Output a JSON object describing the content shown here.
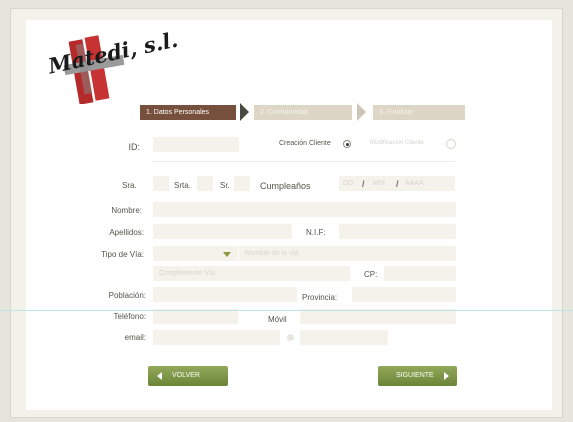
{
  "logo": {
    "text": "Matedi, s.l."
  },
  "steps": [
    {
      "label": "1. Datos Personales"
    },
    {
      "label": "2. Conformidad"
    },
    {
      "label": "3. Finalizar"
    }
  ],
  "form": {
    "id_label": "ID:",
    "creation_label": "Creación Cliente",
    "modify_label": "Modificacion Cliente",
    "sra_label": "Sra.",
    "srta_label": "Srta.",
    "sr_label": "Sr.",
    "birthday_label": "Cumpleaños",
    "dd_placeholder": "DD",
    "mm_placeholder": "MM",
    "yyyy_placeholder": "AAAA",
    "date_separator": "/",
    "name_label": "Nombre:",
    "surname_label": "Apellidos:",
    "nif_label": "N.I.F:",
    "street_type_label": "Tipo de Vía:",
    "street_name_placeholder": "Nombre de la vía",
    "street_complement_placeholder": "Complemento Vía",
    "cp_label": "CP:",
    "city_label": "Población:",
    "province_label": "Provincia:",
    "phone_label": "Teléfono:",
    "mobile_label": "Móvil",
    "email_label": "email:"
  },
  "buttons": {
    "back_label": "VOLVER",
    "next_label": "SIGUIENTE"
  },
  "colors": {
    "step_active": "#76503c",
    "step_inactive": "#ddd6c6",
    "button_green": "#7a9244",
    "field_bg": "#f4f2ea"
  }
}
